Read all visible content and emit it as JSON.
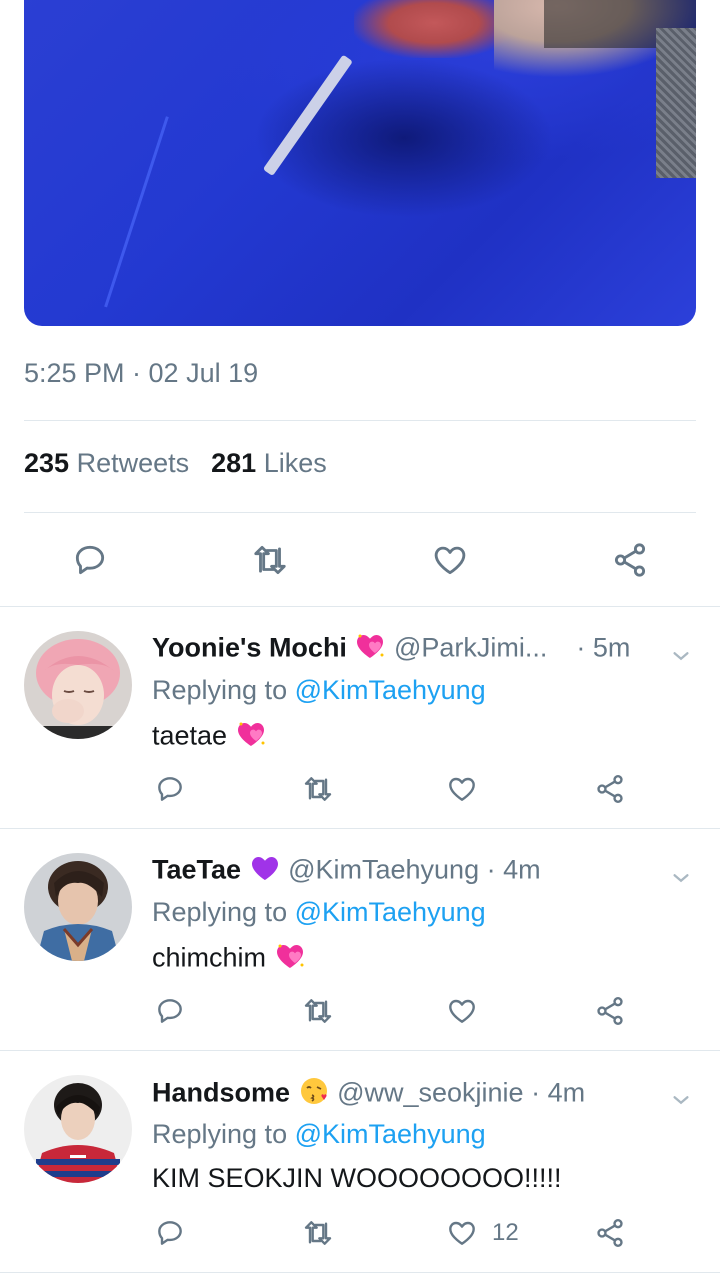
{
  "tweet": {
    "timestamp": "5:25 PM · 02 Jul 19",
    "retweets_count": "235",
    "retweets_label": "Retweets",
    "likes_count": "281",
    "likes_label": "Likes"
  },
  "replies": [
    {
      "name": "Yoonie's Mochi",
      "handle": "@ParkJimi...",
      "time": "· 5m",
      "replying_prefix": "Replying to",
      "replying_to": "@KimTaehyung",
      "text": "taetae",
      "like_count": ""
    },
    {
      "name": "TaeTae",
      "handle": "@KimTaehyung",
      "time": "· 4m",
      "replying_prefix": "Replying to",
      "replying_to": "@KimTaehyung",
      "text": "chimchim",
      "like_count": ""
    },
    {
      "name": "Handsome",
      "handle": "@ww_seokjinie",
      "time": "· 4m",
      "replying_prefix": "Replying to",
      "replying_to": "@KimTaehyung",
      "text": "KIM SEOKJIN WOOOOOOOO!!!!!",
      "like_count": "12"
    }
  ],
  "icons": {
    "reply": "reply-icon",
    "retweet": "retweet-icon",
    "like": "heart-icon",
    "share": "share-icon",
    "caret": "chevron-down-icon",
    "emoji_heart": "sparkling-heart-emoji",
    "emoji_purple": "purple-heart-emoji",
    "emoji_kiss": "kissing-face-emoji"
  },
  "colors": {
    "text": "#14171a",
    "secondary": "#657786",
    "link": "#1da1f2",
    "divider": "#e1e8ed"
  }
}
